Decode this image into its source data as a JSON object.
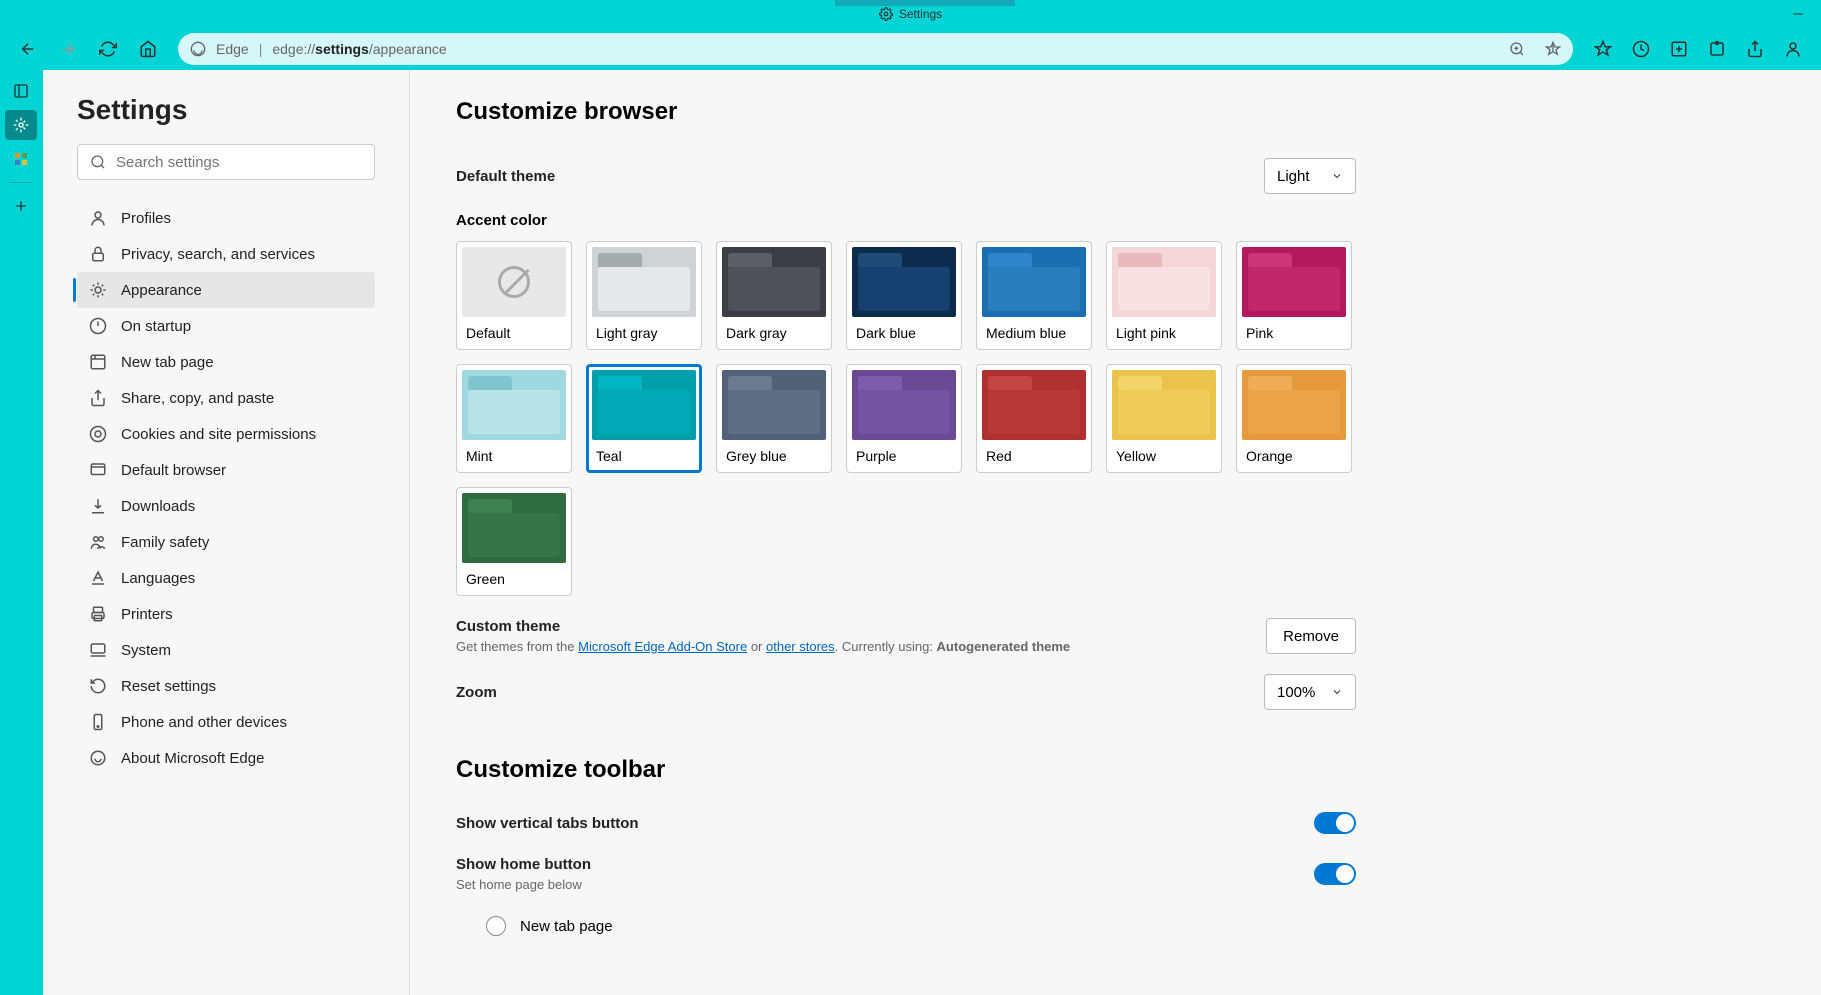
{
  "titlebar": {
    "tab_label": "Settings"
  },
  "address": {
    "scheme_label": "Edge",
    "url_prefix": "edge://",
    "url_bold": "settings",
    "url_rest": "/appearance"
  },
  "sidebar": {
    "title": "Settings",
    "search_placeholder": "Search settings",
    "items": [
      "Profiles",
      "Privacy, search, and services",
      "Appearance",
      "On startup",
      "New tab page",
      "Share, copy, and paste",
      "Cookies and site permissions",
      "Default browser",
      "Downloads",
      "Family safety",
      "Languages",
      "Printers",
      "System",
      "Reset settings",
      "Phone and other devices",
      "About Microsoft Edge"
    ],
    "active": 2
  },
  "customize_browser": {
    "heading": "Customize browser",
    "default_theme_label": "Default theme",
    "default_theme_value": "Light",
    "accent_label": "Accent color",
    "accent_selected": 7,
    "swatches": [
      {
        "name": "Default",
        "bg": "#e8e8e8",
        "tab": "",
        "body": "",
        "default": true
      },
      {
        "name": "Light gray",
        "bg": "#cfd3d6",
        "tab": "#a6abae",
        "body": "#e5e7e8"
      },
      {
        "name": "Dark gray",
        "bg": "#3b3f43",
        "tab": "#5c6064",
        "body": "#4e5256"
      },
      {
        "name": "Dark blue",
        "bg": "#0d2b4b",
        "tab": "#1e4a78",
        "body": "#164070"
      },
      {
        "name": "Medium blue",
        "bg": "#1a6fb0",
        "tab": "#2c86c9",
        "body": "#2b7ebd"
      },
      {
        "name": "Light pink",
        "bg": "#f4d6d9",
        "tab": "#e7b8bd",
        "body": "#f7e1e3"
      },
      {
        "name": "Pink",
        "bg": "#b31a5e",
        "tab": "#c93576",
        "body": "#c12869"
      },
      {
        "name": "Mint",
        "bg": "#9fd8df",
        "tab": "#7fc5cf",
        "body": "#b8e3e8"
      },
      {
        "name": "Teal",
        "bg": "#009faa",
        "tab": "#00b6c2",
        "body": "#00a9b5"
      },
      {
        "name": "Grey blue",
        "bg": "#536178",
        "tab": "#6b7a91",
        "body": "#5f6e85"
      },
      {
        "name": "Purple",
        "bg": "#6a4a95",
        "tab": "#7e5dad",
        "body": "#7454a2"
      },
      {
        "name": "Red",
        "bg": "#b03030",
        "tab": "#c54545",
        "body": "#b93838"
      },
      {
        "name": "Yellow",
        "bg": "#e9c34b",
        "tab": "#f2d468",
        "body": "#efcb58"
      },
      {
        "name": "Orange",
        "bg": "#e79a3c",
        "tab": "#efad57",
        "body": "#eba349"
      },
      {
        "name": "Green",
        "bg": "#2e6b3e",
        "tab": "#3e8050",
        "body": "#357547"
      }
    ],
    "custom_label": "Custom theme",
    "custom_remove": "Remove",
    "custom_desc_prefix": "Get themes from the ",
    "custom_link1": "Microsoft Edge Add-On Store",
    "custom_mid": " or ",
    "custom_link2": "other stores",
    "custom_suffix": ". Currently using: ",
    "custom_current": "Autogenerated theme",
    "zoom_label": "Zoom",
    "zoom_value": "100%"
  },
  "customize_toolbar": {
    "heading": "Customize toolbar",
    "vertical_tabs_label": "Show vertical tabs button",
    "home_button_label": "Show home button",
    "home_button_sub": "Set home page below",
    "radio_new_tab": "New tab page"
  }
}
